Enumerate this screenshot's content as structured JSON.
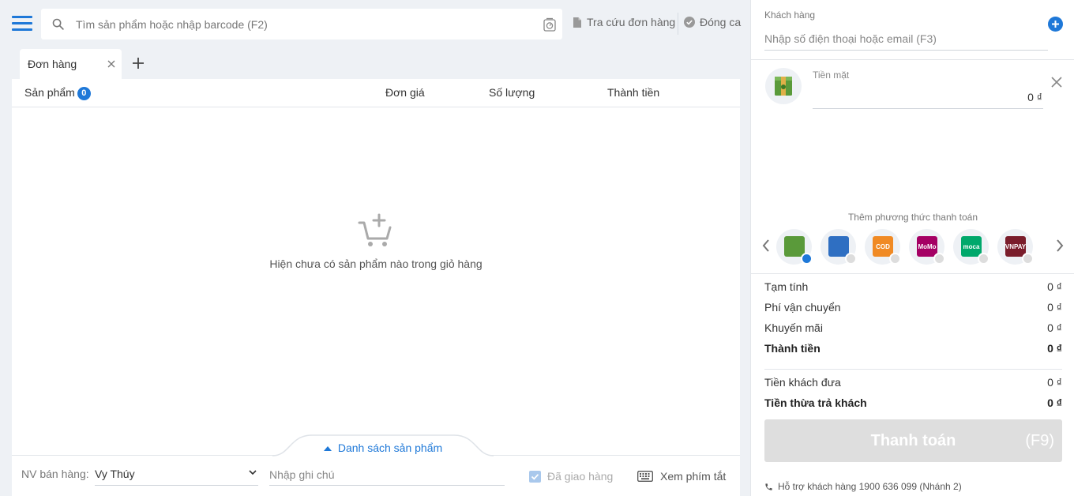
{
  "search": {
    "placeholder": "Tìm sản phẩm hoặc nhập barcode (F2)"
  },
  "top_links": {
    "lookup": "Tra cứu đơn hàng",
    "close_shift": "Đóng ca"
  },
  "tab": {
    "label": "Đơn hàng"
  },
  "table": {
    "col_product": "Sản phẩm",
    "product_count": "0",
    "col_price": "Đơn giá",
    "col_qty": "Số lượng",
    "col_total": "Thành tiền"
  },
  "empty_message": "Hiện chưa có sản phẩm nào trong giỏ hàng",
  "product_list_toggle": "Danh sách sản phẩm",
  "bottom": {
    "staff_label": "NV bán hàng:",
    "staff_value": "Vy Thúy",
    "note_placeholder": "Nhập ghi chú",
    "delivered_label": "Đã giao hàng",
    "shortcut_label": "Xem phím tắt"
  },
  "customer": {
    "label": "Khách hàng",
    "placeholder": "Nhập số điện thoại hoặc email (F3)"
  },
  "payment": {
    "cash_label": "Tiền mặt",
    "cash_amount": "0 ₫",
    "add_method_label": "Thêm phương thức thanh toán",
    "methods": [
      {
        "name": "cash",
        "text": "",
        "color": "#5a9a3a",
        "selected": true
      },
      {
        "name": "bank",
        "text": "",
        "color": "#2f6fc2",
        "selected": false
      },
      {
        "name": "cod",
        "text": "COD",
        "color": "#f08a24",
        "selected": false
      },
      {
        "name": "momo",
        "text": "MoMo",
        "color": "#a50064",
        "selected": false
      },
      {
        "name": "moca",
        "text": "moca",
        "color": "#00a86b",
        "selected": false
      },
      {
        "name": "vnpay",
        "text": "VNPAY",
        "color": "#7a1d2b",
        "selected": false
      }
    ]
  },
  "summary": {
    "subtotal_label": "Tạm tính",
    "subtotal_value": "0 ₫",
    "shipping_label": "Phí vận chuyển",
    "shipping_value": "0 ₫",
    "discount_label": "Khuyến mãi",
    "discount_value": "0 ₫",
    "total_label": "Thành tiền",
    "total_value": "0 ₫",
    "paid_label": "Tiền khách đưa",
    "paid_value": "0 ₫",
    "change_label": "Tiền thừa trả khách",
    "change_value": "0 ₫"
  },
  "checkout": {
    "label": "Thanh toán",
    "key": "(F9)"
  },
  "support": {
    "text": "Hỗ trợ khách hàng 1900 636 099 (Nhánh 2)"
  },
  "colors": {
    "accent": "#1e78d8",
    "background": "#eef1f5"
  }
}
